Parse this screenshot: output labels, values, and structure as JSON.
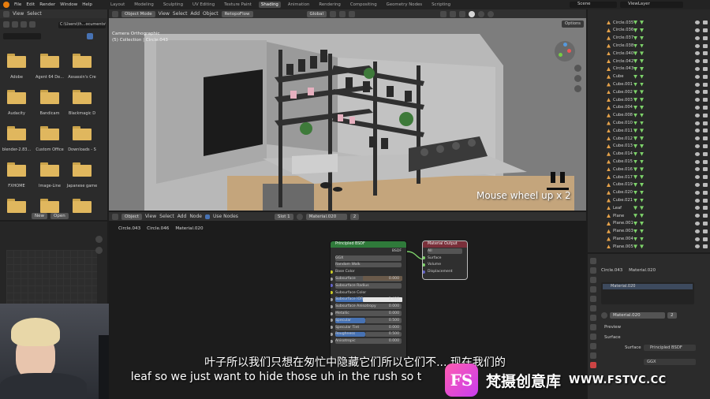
{
  "topbar": {
    "menus": [
      "File",
      "Edit",
      "Render",
      "Window",
      "Help"
    ],
    "workspaces": [
      "Layout",
      "Modeling",
      "Sculpting",
      "UV Editing",
      "Texture Paint",
      "Shading",
      "Animation",
      "Rendering",
      "Compositing",
      "Geometry Nodes",
      "Scripting"
    ],
    "active_workspace": "Shading",
    "scene": "Scene",
    "view_layer": "ViewLayer"
  },
  "file_browser": {
    "header": [
      "View",
      "Select"
    ],
    "path": "C:\\Users\\th...ocuments\\",
    "folders": [
      "Adobe",
      "Agent 64 De...",
      "Assassin's Cre",
      "Audacity",
      "Bandicam",
      "Blackmagic D",
      "blender-2.83...",
      "Custom Office",
      "Downloads - S",
      "FXHOME",
      "Image-Line",
      "Japanese game",
      "",
      "",
      ""
    ],
    "new_label": "New",
    "open_label": "Open"
  },
  "viewport_header": {
    "mode": "Object Mode",
    "menus": [
      "View",
      "Select",
      "Add",
      "Object"
    ],
    "topo": "RetopoFlow",
    "orientation": "Global",
    "options": "Options"
  },
  "viewport": {
    "camera_text": "Camera Orthographic",
    "collection_text": "(5) Collection | Circle.043",
    "overlay_text": "Mouse wheel up x 2"
  },
  "outliner": {
    "items": [
      "Circle.035",
      "Circle.036",
      "Circle.037",
      "Circle.038",
      "Circle.040",
      "Circle.042",
      "Circle.043",
      "Cube",
      "Cube.001",
      "Cube.002",
      "Cube.003",
      "Cube.004",
      "Cube.008",
      "Cube.010",
      "Cube.011",
      "Cube.012",
      "Cube.013",
      "Cube.014",
      "Cube.015",
      "Cube.016",
      "Cube.017",
      "Cube.019",
      "Cube.020",
      "Cube.021",
      "Leaf",
      "Plane",
      "Plane.001",
      "Plane.003",
      "Plane.004",
      "Plane.005"
    ]
  },
  "node_editor_header": {
    "type": "Object",
    "menus": [
      "View",
      "Select",
      "Add",
      "Node"
    ],
    "use_nodes": "Use Nodes",
    "slot": "Slot 1",
    "material": "Material.020",
    "users": "2"
  },
  "breadcrumb": [
    "Circle.043",
    "Circle.046",
    "Material.020"
  ],
  "principled_node": {
    "title": "Principled BSDF",
    "output": "BSDF",
    "distribution": "GGX",
    "subsurface_method": "Random Walk",
    "rows": [
      {
        "label": "Base Color",
        "value": "",
        "socket": "y",
        "field": "none"
      },
      {
        "label": "Subsurface",
        "value": "0.000",
        "socket": "g",
        "field": "grey"
      },
      {
        "label": "Subsurface Radius",
        "value": "",
        "socket": "b",
        "field": "grey"
      },
      {
        "label": "Subsurface Color",
        "value": "",
        "socket": "y",
        "field": "none"
      },
      {
        "label": "Subsurface IOR",
        "value": "1.400",
        "socket": "g",
        "field": "blue"
      },
      {
        "label": "Subsurface Anisotropy",
        "value": "0.000",
        "socket": "g",
        "field": "grey"
      },
      {
        "label": "Metallic",
        "value": "0.000",
        "socket": "g",
        "field": "grey"
      },
      {
        "label": "Specular",
        "value": "0.500",
        "socket": "g",
        "field": "blue"
      },
      {
        "label": "Specular Tint",
        "value": "0.000",
        "socket": "g",
        "field": "grey"
      },
      {
        "label": "Roughness",
        "value": "0.500",
        "socket": "g",
        "field": "blue"
      },
      {
        "label": "Anisotropic",
        "value": "0.000",
        "socket": "g",
        "field": "grey"
      }
    ]
  },
  "output_node": {
    "title": "Material Output",
    "target": "All",
    "inputs": [
      "Surface",
      "Volume",
      "Displacement"
    ]
  },
  "properties": {
    "object": "Circle.043",
    "material": "Material.020",
    "slot_name": "Material.020",
    "field_material": "Material.020",
    "users": "2",
    "preview": "Preview",
    "surface_section": "Surface",
    "surface_label": "Surface",
    "surface_value": "Principled BSDF",
    "distribution": "GGX"
  },
  "subtitles": {
    "chinese": "叶子所以我们只想在匆忙中隐藏它们所以它们不... 现在我们的",
    "english": "leaf so we just want to hide those uh in the rush so t"
  },
  "brand": {
    "badge": "FS",
    "name": "梵摄创意库",
    "url": "WWW.FSTVC.CC"
  }
}
